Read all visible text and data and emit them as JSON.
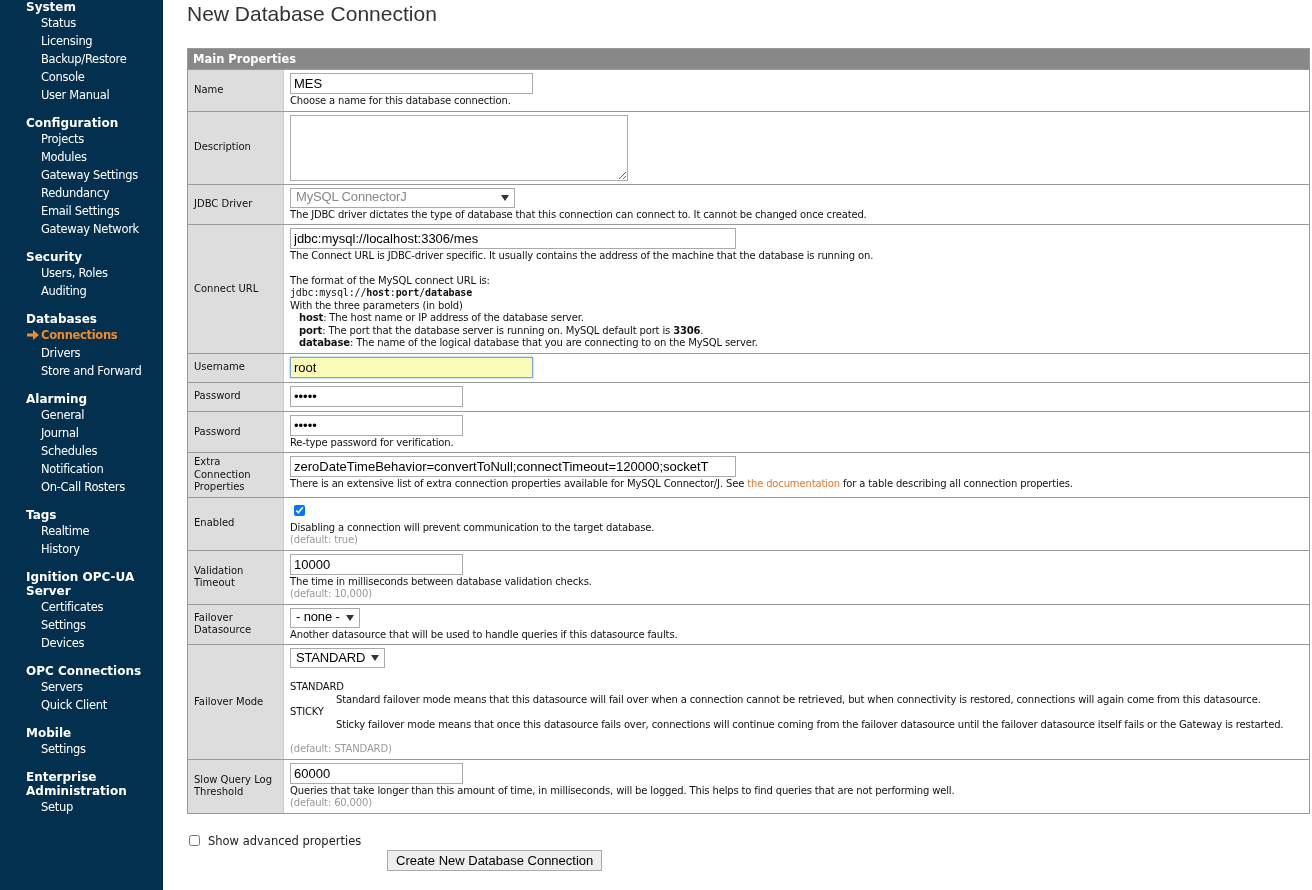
{
  "sidebar": {
    "groups": [
      {
        "title": "System",
        "items": [
          {
            "label": "Status",
            "selected": false
          },
          {
            "label": "Licensing",
            "selected": false
          },
          {
            "label": "Backup/Restore",
            "selected": false
          },
          {
            "label": "Console",
            "selected": false
          },
          {
            "label": "User Manual",
            "selected": false
          }
        ]
      },
      {
        "title": "Configuration",
        "items": [
          {
            "label": "Projects",
            "selected": false
          },
          {
            "label": "Modules",
            "selected": false
          },
          {
            "label": "Gateway Settings",
            "selected": false
          },
          {
            "label": "Redundancy",
            "selected": false
          },
          {
            "label": "Email Settings",
            "selected": false
          },
          {
            "label": "Gateway Network",
            "selected": false
          }
        ]
      },
      {
        "title": "Security",
        "items": [
          {
            "label": "Users, Roles",
            "selected": false
          },
          {
            "label": "Auditing",
            "selected": false
          }
        ]
      },
      {
        "title": "Databases",
        "items": [
          {
            "label": "Connections",
            "selected": true
          },
          {
            "label": "Drivers",
            "selected": false
          },
          {
            "label": "Store and Forward",
            "selected": false
          }
        ]
      },
      {
        "title": "Alarming",
        "items": [
          {
            "label": "General",
            "selected": false
          },
          {
            "label": "Journal",
            "selected": false
          },
          {
            "label": "Schedules",
            "selected": false
          },
          {
            "label": "Notification",
            "selected": false
          },
          {
            "label": "On-Call Rosters",
            "selected": false
          }
        ]
      },
      {
        "title": "Tags",
        "items": [
          {
            "label": "Realtime",
            "selected": false
          },
          {
            "label": "History",
            "selected": false
          }
        ]
      },
      {
        "title": "Ignition OPC-UA Server",
        "items": [
          {
            "label": "Certificates",
            "selected": false
          },
          {
            "label": "Settings",
            "selected": false
          },
          {
            "label": "Devices",
            "selected": false
          }
        ]
      },
      {
        "title": "OPC Connections",
        "items": [
          {
            "label": "Servers",
            "selected": false
          },
          {
            "label": "Quick Client",
            "selected": false
          }
        ]
      },
      {
        "title": "Mobile",
        "items": [
          {
            "label": "Settings",
            "selected": false
          }
        ]
      },
      {
        "title": "Enterprise Administration",
        "items": [
          {
            "label": "Setup",
            "selected": false
          }
        ]
      }
    ]
  },
  "page_title": "New Database Connection",
  "section_title": "Main Properties",
  "rows": [
    {
      "label": "Name",
      "kind": "text",
      "value": "MES",
      "focused": false,
      "help": "Choose a name for this database connection."
    },
    {
      "label": "Description",
      "kind": "textarea"
    },
    {
      "label": "JDBC Driver",
      "kind": "select",
      "value": "MySQL ConnectorJ",
      "disabled": true,
      "help": "The JDBC driver dictates the type of database that this connection can connect to. It cannot be changed once created."
    },
    {
      "label": "Connect URL",
      "kind": "text",
      "value": "jdbc:mysql://localhost:3306/mes",
      "focused": false,
      "help": "The Connect URL is JDBC-driver specific. It usually contains the address of the machine that the database is running on.",
      "notes": [
        {
          "kind": "text",
          "text": "The format of the MySQL connect URL is:"
        },
        {
          "kind": "code",
          "text": "jdbc:mysql://**host**:**port**/**database**"
        },
        {
          "kind": "text",
          "text": "With the three parameters (in bold)"
        },
        {
          "kind": "param",
          "text": "**host**: The host name or IP address of the database server."
        },
        {
          "kind": "param",
          "text": "**port**: The port that the database server is running on. MySQL default port is **3306**."
        },
        {
          "kind": "param",
          "text": "**database**: The name of the logical database that you are connecting to on the MySQL server."
        }
      ]
    },
    {
      "label": "Username",
      "kind": "text",
      "value": "root",
      "focused": true
    },
    {
      "label": "Password",
      "kind": "text",
      "value": "•••••",
      "focused": false
    },
    {
      "label": "Password",
      "kind": "text",
      "value": "•••••",
      "focused": false,
      "help": "Re-type password for verification."
    },
    {
      "label": "Extra Connection Properties",
      "kind": "text",
      "value": "zeroDateTimeBehavior=convertToNull;connectTimeout=120000;socketT",
      "focused": false,
      "help": "There is an extensive list of extra connection properties available for MySQL Connector/J. See ",
      "link": "the documentation",
      "help_after": " for a table describing all connection properties."
    },
    {
      "label": "Enabled",
      "kind": "checkbox",
      "checked": true,
      "help": "Disabling a connection will prevent communication to the target database.",
      "default": "(default: true)"
    },
    {
      "label": "Validation Timeout",
      "kind": "text",
      "value": "10000",
      "focused": false,
      "help": "The time in milliseconds between database validation checks.",
      "default": "(default: 10,000)"
    },
    {
      "label": "Failover Datasource",
      "kind": "select",
      "value": "- none -",
      "disabled": false,
      "help": "Another datasource that will be used to handle queries if this datasource faults."
    },
    {
      "label": "Failover Mode",
      "kind": "select",
      "value": "STANDARD",
      "disabled": false,
      "modes": [
        {
          "term": "STANDARD",
          "desc": "Standard failover mode means that this datasource will fail over when a connection cannot be retrieved, but when connectivity is restored, connections will again come from this datasource."
        },
        {
          "term": "STICKY",
          "desc": "Sticky failover mode means that once this datasource fails over, connections will continue coming from the failover datasource until the failover datasource itself fails or the Gateway is restarted."
        }
      ],
      "default": "(default: STANDARD)"
    },
    {
      "label": "Slow Query Log Threshold",
      "kind": "text",
      "value": "60000",
      "focused": false,
      "help": "Queries that take longer than this amount of time, in milliseconds, will be logged. This helps to find queries that are not performing well.",
      "default": "(default: 60,000)"
    }
  ],
  "advanced": {
    "label": "Show advanced properties",
    "checked": false
  },
  "submit": "Create New Database Connection"
}
